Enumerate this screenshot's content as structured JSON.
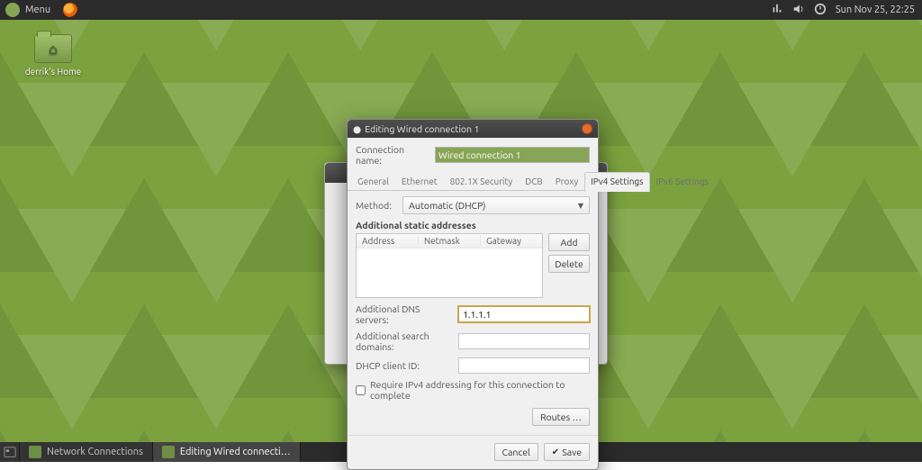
{
  "top_panel": {
    "menu_label": "Menu",
    "clock": "Sun Nov 25, 22:25"
  },
  "desktop": {
    "home_icon_label": "derrik's Home"
  },
  "dialog": {
    "title": "Editing Wired connection 1",
    "connection_name_label": "Connection name:",
    "connection_name_value": "Wired connection 1",
    "tabs": [
      "General",
      "Ethernet",
      "802.1X Security",
      "DCB",
      "Proxy",
      "IPv4 Settings",
      "IPv6 Settings"
    ],
    "active_tab_index": 5,
    "method_label": "Method:",
    "method_value": "Automatic (DHCP)",
    "addresses_header": "Additional static addresses",
    "addr_cols": {
      "address": "Address",
      "netmask": "Netmask",
      "gateway": "Gateway"
    },
    "add_btn": "Add",
    "delete_btn": "Delete",
    "dns_label": "Additional DNS servers:",
    "dns_value": "1.1.1.1",
    "search_label": "Additional search domains:",
    "search_value": "",
    "dhcp_client_label": "DHCP client ID:",
    "dhcp_client_value": "",
    "require_checkbox_label": "Require IPv4 addressing for this connection to complete",
    "require_checked": false,
    "routes_btn": "Routes …",
    "cancel_btn": "Cancel",
    "save_btn": "Save"
  },
  "taskbar": {
    "task1": "Network Connections",
    "task2": "Editing Wired connecti…"
  }
}
